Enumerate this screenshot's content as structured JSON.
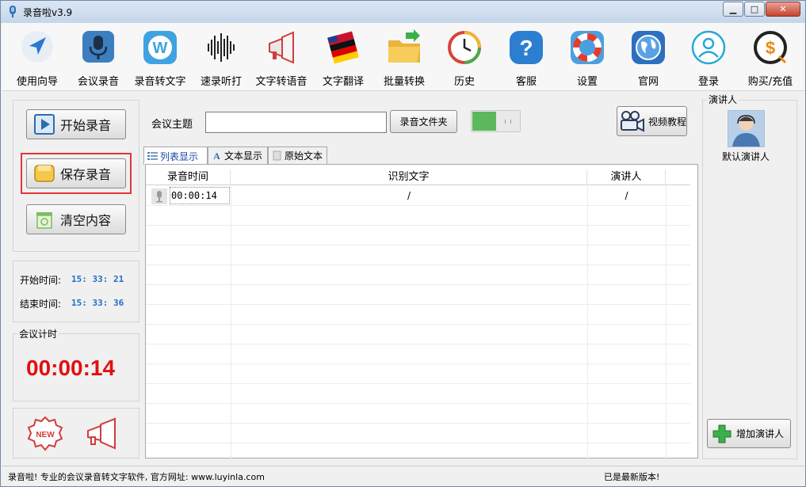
{
  "window": {
    "title": "录音啦v3.9",
    "minimize": "▁",
    "maximize": "□",
    "close": "✕"
  },
  "toolbar": {
    "items": [
      {
        "label": "使用向导",
        "icon": "navigation-arrow-icon"
      },
      {
        "label": "会议录音",
        "icon": "microphone-icon"
      },
      {
        "label": "录音转文字",
        "icon": "w-letter-icon"
      },
      {
        "label": "速录听打",
        "icon": "soundwave-icon"
      },
      {
        "label": "文字转语音",
        "icon": "megaphone-icon"
      },
      {
        "label": "文字翻译",
        "icon": "flags-icon"
      },
      {
        "label": "批量转换",
        "icon": "folder-icon"
      },
      {
        "label": "历史",
        "icon": "clock-icon"
      },
      {
        "label": "客服",
        "icon": "question-icon"
      },
      {
        "label": "设置",
        "icon": "lifebuoy-icon"
      },
      {
        "label": "官网",
        "icon": "globe-icon"
      },
      {
        "label": "登录",
        "icon": "user-icon"
      },
      {
        "label": "购买/充值",
        "icon": "dollar-icon"
      }
    ]
  },
  "left": {
    "start_record": "开始录音",
    "save_record": "保存录音",
    "clear": "清空内容",
    "start_time_label": "开始时间:",
    "start_time": "15: 33: 21",
    "end_time_label": "结束时间:",
    "end_time": "15: 33: 36",
    "meeting_timer_title": "会议计时",
    "timer": "00:00:14"
  },
  "main": {
    "topic_label": "会议主题",
    "topic_value": "",
    "folder_button": "录音文件夹",
    "video_button": "视频教程",
    "tabs": [
      {
        "label": "列表显示"
      },
      {
        "label": "文本显示"
      },
      {
        "label": "原始文本"
      }
    ],
    "columns": [
      "录音时间",
      "识别文字",
      "演讲人"
    ],
    "rows": [
      {
        "time": "00:00:14",
        "text": "/",
        "speaker": "/"
      }
    ]
  },
  "right": {
    "title": "演讲人",
    "default_speaker": "默认演讲人",
    "add_speaker": "增加演讲人"
  },
  "status": {
    "left": "录音啦! 专业的会议录音转文字软件, 官方网址: www.luyinla.com",
    "right": "已是最新版本!"
  },
  "colors": {
    "accent_red": "#e01010",
    "time_blue": "#1f6ec4",
    "highlight_border": "#e0373a",
    "toggle_green": "#5cb85c"
  }
}
